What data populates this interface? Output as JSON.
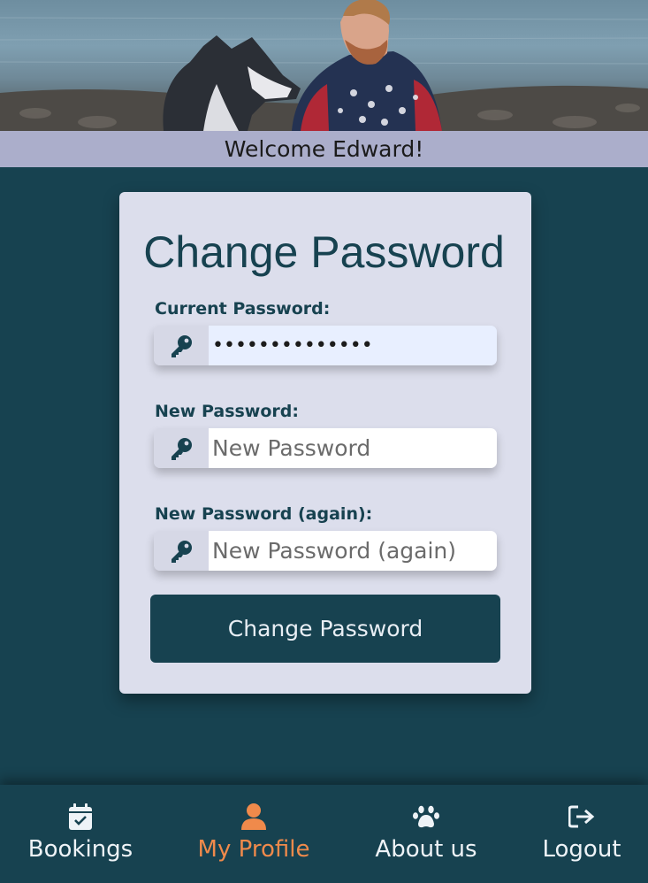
{
  "header": {
    "welcome_text": "Welcome Edward!"
  },
  "form": {
    "title": "Change Password",
    "fields": [
      {
        "label": "Current Password:",
        "value": "••••••••••••••",
        "placeholder": "",
        "icon": "key-icon"
      },
      {
        "label": "New Password:",
        "value": "",
        "placeholder": "New Password",
        "icon": "key-icon"
      },
      {
        "label": "New Password (again):",
        "value": "",
        "placeholder": "New Password (again)",
        "icon": "key-icon"
      }
    ],
    "submit_label": "Change Password"
  },
  "nav": {
    "items": [
      {
        "label": "Bookings",
        "icon": "calendar-check-icon",
        "active": false
      },
      {
        "label": "My Profile",
        "icon": "user-icon",
        "active": true
      },
      {
        "label": "About us",
        "icon": "paw-icon",
        "active": false
      },
      {
        "label": "Logout",
        "icon": "sign-out-icon",
        "active": false
      }
    ]
  },
  "colors": {
    "primary": "#174250",
    "accent": "#f08a4b",
    "card_bg": "#dcdeec",
    "welcome_bar": "#abaecb"
  }
}
